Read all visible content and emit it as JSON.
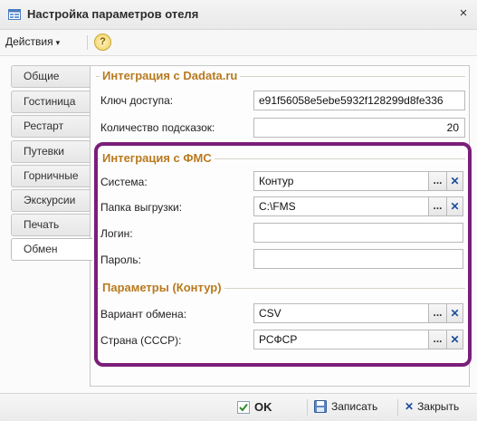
{
  "window": {
    "title": "Настройка параметров отеля",
    "close_glyph": "×"
  },
  "menubar": {
    "actions_label": "Действия",
    "actions_caret": "▾",
    "help_glyph": "?"
  },
  "tabs": [
    {
      "label": "Общие",
      "active": false
    },
    {
      "label": "Гостиница",
      "active": false
    },
    {
      "label": "Рестарт",
      "active": false
    },
    {
      "label": "Путевки",
      "active": false
    },
    {
      "label": "Горничные",
      "active": false
    },
    {
      "label": "Экскурсии",
      "active": false
    },
    {
      "label": "Печать",
      "active": false
    },
    {
      "label": "Обмен",
      "active": true
    }
  ],
  "dadata": {
    "title": "Интеграция с Dadata.ru",
    "api_key_label": "Ключ доступа:",
    "api_key_value": "e91f56058e5ebe5932f128299d8fe336",
    "hints_count_label": "Количество подсказок:",
    "hints_count_value": "20"
  },
  "fms": {
    "title": "Интеграция с ФМС",
    "system_label": "Система:",
    "system_value": "Контур",
    "export_folder_label": "Папка выгрузки:",
    "export_folder_value": "C:\\FMS",
    "login_label": "Логин:",
    "login_value": "",
    "password_label": "Пароль:",
    "password_value": ""
  },
  "kontur": {
    "title": "Параметры (Контур)",
    "exchange_variant_label": "Вариант обмена:",
    "exchange_variant_value": "CSV",
    "country_label": "Страна (СССР):",
    "country_value": "РСФСР"
  },
  "buttons": {
    "picker_glyph": "...",
    "clear_glyph": "✕"
  },
  "bottombar": {
    "ok_label": "OK",
    "save_label": "Записать",
    "close_label": "Закрыть",
    "close_glyph": "✕"
  },
  "colors": {
    "highlight": "#7b1e7a",
    "group_title": "#b87a1f"
  }
}
